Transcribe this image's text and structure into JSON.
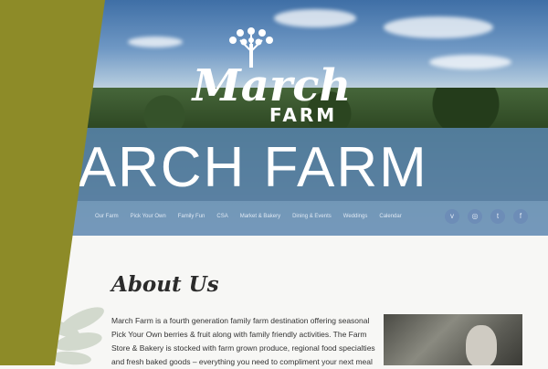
{
  "logo": {
    "script": "March",
    "farm": "FARM"
  },
  "banner": {
    "title": "MARCH FARM"
  },
  "nav": {
    "items": [
      "Our Farm",
      "Pick Your Own",
      "Family Fun",
      "CSA",
      "Market & Bakery",
      "Dining & Events",
      "Weddings",
      "Calendar"
    ]
  },
  "social": {
    "icons": [
      "vimeo-icon",
      "instagram-icon",
      "twitter-icon",
      "facebook-icon"
    ],
    "glyphs": [
      "v",
      "◎",
      "t",
      "f"
    ]
  },
  "about": {
    "heading": "About Us",
    "paragraph": "March Farm is a fourth generation family farm destination offering seasonal Pick Your Own berries & fruit along with family friendly activities. The Farm Store & Bakery is stocked with farm grown produce, regional food specialties and fresh baked goods – everything you need to compliment your next meal"
  },
  "colors": {
    "olive": "#8d8b28",
    "banner_blue": "#5078af",
    "nav_blue": "#7096c3"
  }
}
